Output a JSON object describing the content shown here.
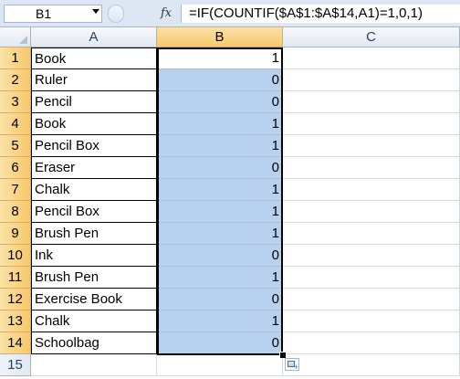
{
  "formula_bar": {
    "name_box": "B1",
    "fx_icon": "fx",
    "formula": "=IF(COUNTIF($A$1:$A$14,A1)=1,0,1)"
  },
  "columns": [
    "A",
    "B",
    "C"
  ],
  "rows": [
    {
      "num": "1",
      "a": "Book",
      "b": "1"
    },
    {
      "num": "2",
      "a": "Ruler",
      "b": "0"
    },
    {
      "num": "3",
      "a": "Pencil",
      "b": "0"
    },
    {
      "num": "4",
      "a": "Book",
      "b": "1"
    },
    {
      "num": "5",
      "a": "Pencil Box",
      "b": "1"
    },
    {
      "num": "6",
      "a": "Eraser",
      "b": "0"
    },
    {
      "num": "7",
      "a": "Chalk",
      "b": "1"
    },
    {
      "num": "8",
      "a": "Pencil Box",
      "b": "1"
    },
    {
      "num": "9",
      "a": "Brush Pen",
      "b": "1"
    },
    {
      "num": "10",
      "a": "Ink",
      "b": "0"
    },
    {
      "num": "11",
      "a": "Brush Pen",
      "b": "1"
    },
    {
      "num": "12",
      "a": "Exercise Book",
      "b": "0"
    },
    {
      "num": "13",
      "a": "Chalk",
      "b": "1"
    },
    {
      "num": "14",
      "a": "Schoolbag",
      "b": "0"
    },
    {
      "num": "15",
      "a": "",
      "b": ""
    }
  ],
  "icons": {
    "name_box_dropdown": "chevron-down-icon",
    "autofill_options": "auto-fill-options-icon"
  },
  "colors": {
    "selection_fill": "#b8d1ef",
    "header_selected": "#f8c86c",
    "gridline": "#d0d7e5"
  }
}
